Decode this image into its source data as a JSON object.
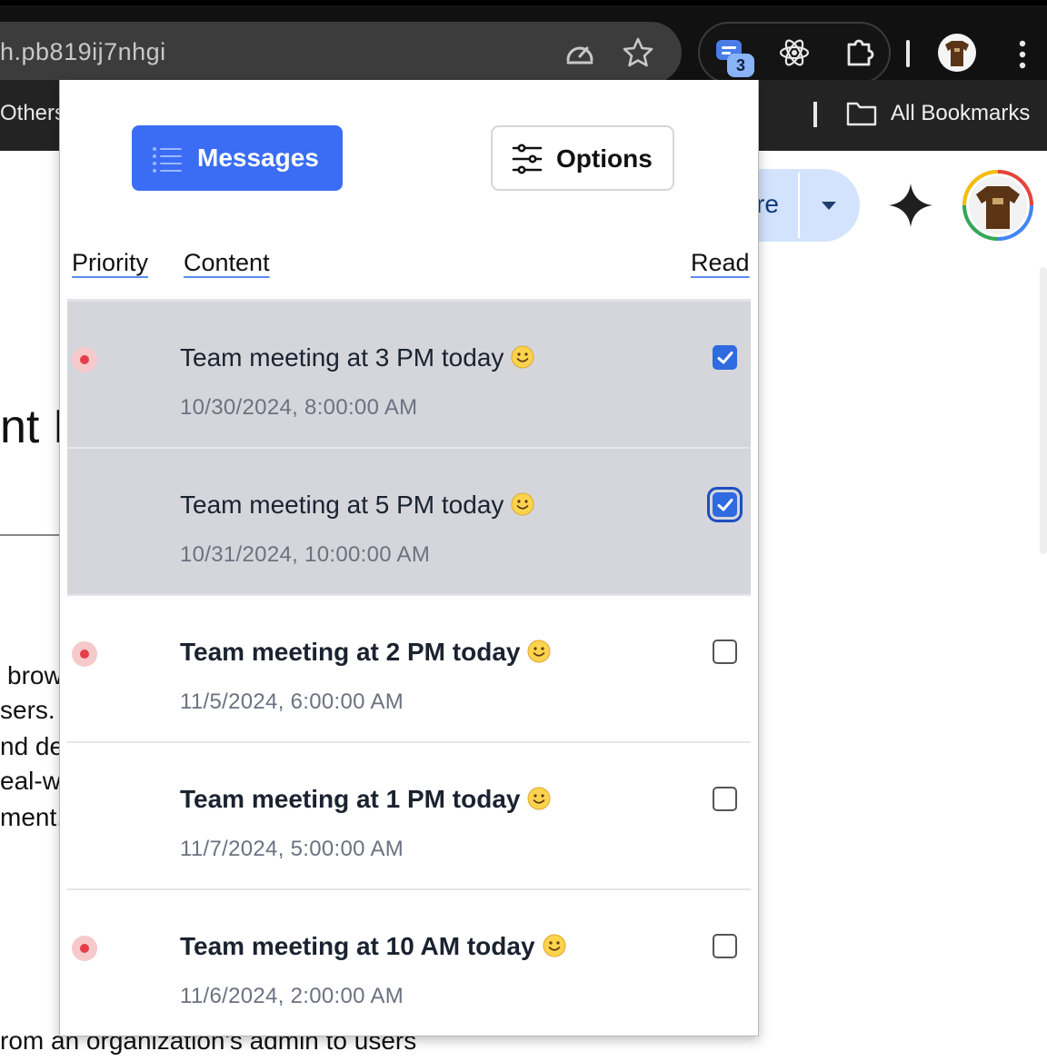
{
  "browser": {
    "url": "h.pb819ij7nhgi",
    "extension_badge": "3",
    "bookmarks": {
      "left_item": "Others",
      "all_bookmarks": "All Bookmarks"
    }
  },
  "page": {
    "share_button_fragment": "re",
    "heading_fragment": "nt I",
    "body_fragments": [
      "brow",
      "sers.",
      "nd de",
      "eal-w",
      "ment."
    ],
    "footer_fragment": "rom an organization's admin to users"
  },
  "popup": {
    "tabs": {
      "messages_label": "Messages",
      "options_label": "Options"
    },
    "columns": {
      "priority": "Priority",
      "content": "Content",
      "read": "Read"
    },
    "rows": [
      {
        "text": "Team meeting at 3 PM today",
        "timestamp": "10/30/2024, 8:00:00 AM",
        "priority": true,
        "read": true
      },
      {
        "text": "Team meeting at 5 PM today",
        "timestamp": "10/31/2024, 10:00:00 AM",
        "priority": false,
        "read": true
      },
      {
        "text": "Team meeting at 2 PM today",
        "timestamp": "11/5/2024, 6:00:00 AM",
        "priority": true,
        "read": false
      },
      {
        "text": "Team meeting at 1 PM today",
        "timestamp": "11/7/2024, 5:00:00 AM",
        "priority": false,
        "read": false
      },
      {
        "text": "Team meeting at 10 AM today",
        "timestamp": "11/6/2024, 2:00:00 AM",
        "priority": true,
        "read": false
      }
    ]
  },
  "colors": {
    "accent": "#3a6cf4",
    "read_row_bg": "#d4d6db",
    "priority_dot": "#e53e4a",
    "checkbox_checked": "#2f6ae0"
  },
  "icons": {
    "omnibox": [
      "performance-icon",
      "bookmark-star-icon"
    ],
    "extensions": [
      "message-extension-icon",
      "react-devtools-icon",
      "extensions-puzzle-icon"
    ],
    "popup": [
      "list-icon",
      "sliders-icon",
      "smile-emoji-icon"
    ]
  }
}
